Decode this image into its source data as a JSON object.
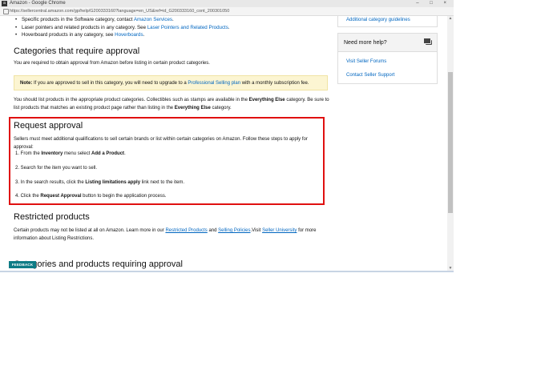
{
  "window": {
    "title": "Amazon - Google Chrome",
    "app_icon": "a",
    "controls": "–  □  ×",
    "url": "https://sellercentral.amazon.com/gp/help/G200333160?language=en_US&ref=id_G200333160_cont_200301050"
  },
  "bullets": [
    {
      "pre": "Specific products in the Software category, contact ",
      "link": "Amazon Services",
      "post": "."
    },
    {
      "pre": "Laser pointers and related products in any category. See ",
      "link": "Laser Pointers and Related Products",
      "post": "."
    },
    {
      "pre": "Hoverboard products in any category, see ",
      "link": "Hoverboards",
      "post": "."
    }
  ],
  "categories_section": {
    "heading": "Categories that require approval",
    "intro": "You are required to obtain approval from Amazon before listing in certain product categories.",
    "note_label": "Note:",
    "note_pre": " If you are approved to sell in this category, you will need to upgrade to a ",
    "note_link": "Professional Selling plan",
    "note_post": " with a monthly subscription fee.",
    "p2_a": "You should list products in the appropriate product categories. Collectibles such as stamps are available in the ",
    "p2_b": "Everything Else",
    "p2_c": " category. Be sure to list products that matches an existing product page rather than listing in the ",
    "p2_d": "Everything Else",
    "p2_e": " category."
  },
  "request_approval": {
    "heading": "Request approval",
    "intro": "Sellers must meet additional qualifications to sell certain brands or list within certain categories on Amazon. Follow these steps to apply for approval:",
    "step1_pre": "1. From the ",
    "step1_b1": "Inventory",
    "step1_mid": " menu select ",
    "step1_b2": "Add a Product",
    "step1_post": ".",
    "step2": "2. Search for the item you want to sell.",
    "step3_pre": "3. In the search results, click the ",
    "step3_b": "Listing limitations apply",
    "step3_post": " link next to the item.",
    "step4_pre": "4. Click the ",
    "step4_b": "Request Approval",
    "step4_post": " button to begin the application process."
  },
  "restricted": {
    "heading": "Restricted products",
    "text_pre": "Certain products may not be listed at all on Amazon. Learn more in our ",
    "link1": "Restricted Products",
    "and": " and ",
    "link2": "Selling Policies",
    "visit": ".Visit ",
    "link3": "Seller University",
    "text_post": " for more information about Listing Restrictions."
  },
  "cut_heading": "Categories and products requiring approval",
  "feedback_label": "FEEDBACK",
  "sidebar": {
    "guidelines_link": "Additional category guidelines",
    "help_heading": "Need more help?",
    "forums_link": "Visit Seller Forums",
    "support_link": "Contact Seller Support"
  }
}
